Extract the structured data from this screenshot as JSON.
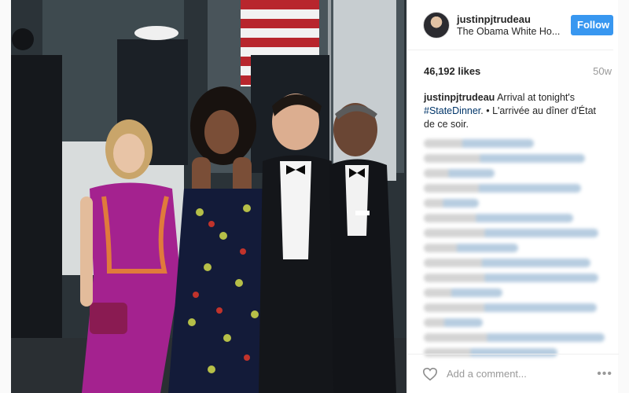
{
  "post": {
    "username": "justinpjtrudeau",
    "location": "The Obama White Ho...",
    "follow_label": "Follow",
    "likes": "46,192 likes",
    "age": "50w",
    "caption": {
      "user": "justinpjtrudeau",
      "text_before": "Arrival at tonight's",
      "hashtag": "#StateDinner",
      "text_after": ". • L'arrivée au dîner d'État de ce soir."
    },
    "comment_placeholder": "Add a comment...",
    "more_label": "•••"
  },
  "icons": {
    "heart": "heart-icon",
    "more": "more-options-icon"
  },
  "colors": {
    "accent": "#3897f0",
    "hashtag": "#003569"
  }
}
